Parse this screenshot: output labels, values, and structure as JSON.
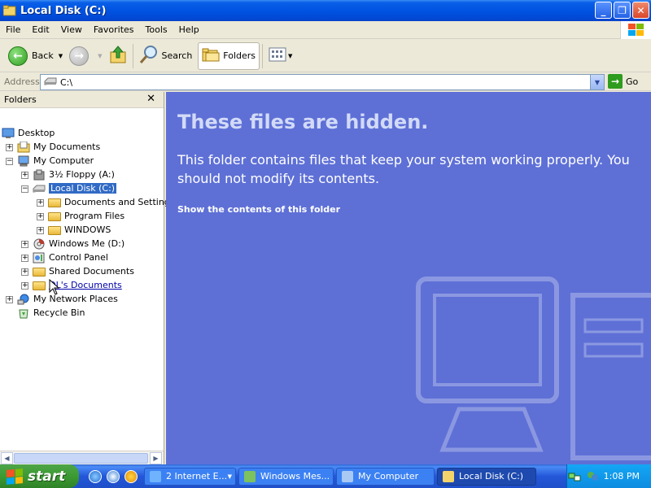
{
  "window": {
    "title": "Local Disk (C:)",
    "buttons": [
      "minimize",
      "maximize",
      "close"
    ]
  },
  "menu": [
    "File",
    "Edit",
    "View",
    "Favorites",
    "Tools",
    "Help"
  ],
  "toolbar": {
    "back_label": "Back",
    "search_label": "Search",
    "folders_label": "Folders"
  },
  "address": {
    "label": "Address",
    "value": "C:\\",
    "go_label": "Go"
  },
  "folders_pane": {
    "title": "Folders",
    "close_glyph": "✕",
    "tree": {
      "desktop": "Desktop",
      "my_documents": "My Documents",
      "my_computer": "My Computer",
      "floppy": "3½ Floppy (A:)",
      "local_disk": "Local Disk (C:)",
      "docs_settings": "Documents and Settings",
      "program_files": "Program Files",
      "windows": "WINDOWS",
      "windows_me": "Windows Me (D:)",
      "control_panel": "Control Panel",
      "shared_documents": "Shared Documents",
      "user_documents": "OL's Documents",
      "network_places": "My Network Places",
      "recycle_bin": "Recycle Bin"
    }
  },
  "content": {
    "title": "These files are hidden.",
    "description": "This folder contains files that keep your system working properly. You should not modify its contents.",
    "show_link": "Show the contents of this folder"
  },
  "taskbar": {
    "start_label": "start",
    "tasks": [
      {
        "label": "2 Internet E...",
        "active": false
      },
      {
        "label": "Windows Mes...",
        "active": false
      },
      {
        "label": "My Computer",
        "active": false
      },
      {
        "label": "Local Disk (C:)",
        "active": true
      }
    ],
    "clock": "1:08 PM"
  },
  "colors": {
    "titlebar": "#0053e1",
    "content_bg": "#5e70d6",
    "selection": "#316ac5",
    "taskbar": "#2457d8",
    "start": "#3c9a33"
  }
}
